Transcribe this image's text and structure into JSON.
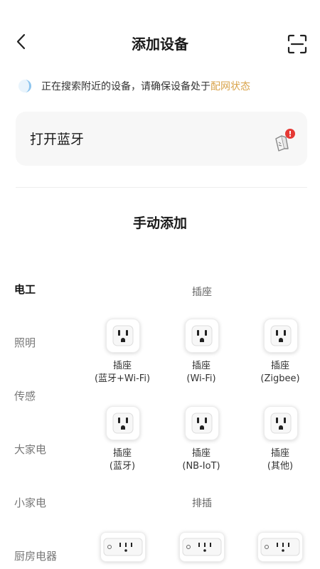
{
  "header": {
    "title": "添加设备"
  },
  "notice": {
    "text": "正在搜索附近的设备，请确保设备处于",
    "link": "配网状态"
  },
  "bluetooth_card": {
    "label": "打开蓝牙",
    "alert_badge": "!"
  },
  "manual_section": {
    "title": "手动添加"
  },
  "categories": [
    {
      "label": "电工"
    },
    {
      "label": "照明"
    },
    {
      "label": "传感"
    },
    {
      "label": "大家电"
    },
    {
      "label": "小家电"
    },
    {
      "label": "厨房电器"
    }
  ],
  "sections": {
    "sockets": {
      "title": "插座",
      "items": [
        {
          "line1": "插座",
          "line2": "(蓝牙+Wi-Fi)"
        },
        {
          "line1": "插座",
          "line2": "(Wi-Fi)"
        },
        {
          "line1": "插座",
          "line2": "(Zigbee)"
        },
        {
          "line1": "插座",
          "line2": "(蓝牙)"
        },
        {
          "line1": "插座",
          "line2": "(NB-IoT)"
        },
        {
          "line1": "插座",
          "line2": "(其他)"
        }
      ]
    },
    "power_strips": {
      "title": "排插"
    }
  },
  "colors": {
    "accent_link": "#d9a44c",
    "alert_red": "#e53935",
    "loader_blue": "#8ec5ee"
  }
}
